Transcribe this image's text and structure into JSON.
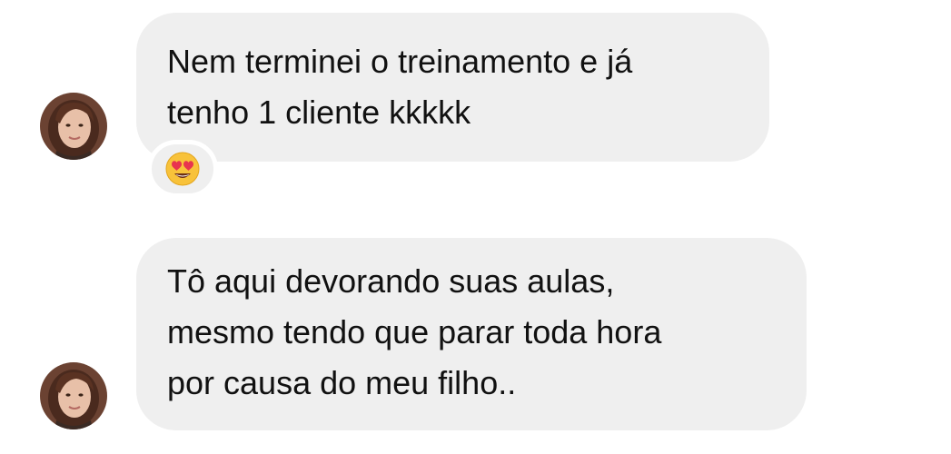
{
  "messages": [
    {
      "lines": [
        "Nem terminei o treinamento e já",
        "tenho 1 cliente kkkkk"
      ],
      "reaction": "heart-eyes-emoji"
    },
    {
      "lines": [
        "Tô aqui devorando suas aulas,",
        "mesmo tendo que parar toda hora",
        "por causa do meu filho.."
      ]
    }
  ],
  "colors": {
    "bubble_bg": "#efefef",
    "text": "#111111",
    "page_bg": "#ffffff"
  }
}
